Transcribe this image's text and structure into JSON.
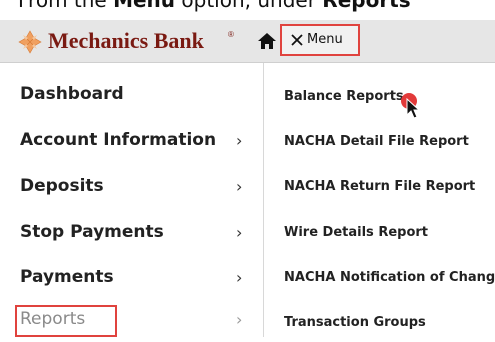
{
  "caption": {
    "part1": "From the ",
    "part2": "Menu",
    "part3": " option, under ",
    "part4": "Reports"
  },
  "header": {
    "brand_name": "Mechanics Bank",
    "brand_mark": "®",
    "menu_label": "Menu",
    "brand_color": "#7a1a12",
    "highlight_color": "#e0433e"
  },
  "left_menu": [
    {
      "label": "Dashboard",
      "chevron": ""
    },
    {
      "label": "Account Information",
      "chevron": "›"
    },
    {
      "label": "Deposits",
      "chevron": "›"
    },
    {
      "label": "Stop Payments",
      "chevron": "›"
    },
    {
      "label": "Payments",
      "chevron": "›"
    },
    {
      "label": "Reports",
      "chevron": "›"
    }
  ],
  "right_menu": [
    {
      "label": "Balance Reports"
    },
    {
      "label": "NACHA Detail File Report"
    },
    {
      "label": "NACHA Return File Report"
    },
    {
      "label": "Wire Details Report"
    },
    {
      "label": "NACHA Notification of Change"
    },
    {
      "label": "Transaction Groups"
    }
  ],
  "icons": {
    "logo": "mechanics-bank-logo-icon",
    "home": "home-icon",
    "close": "close-icon",
    "chevron": "chevron-right-icon",
    "cursor": "mouse-pointer-icon",
    "click": "click-indicator-icon"
  }
}
